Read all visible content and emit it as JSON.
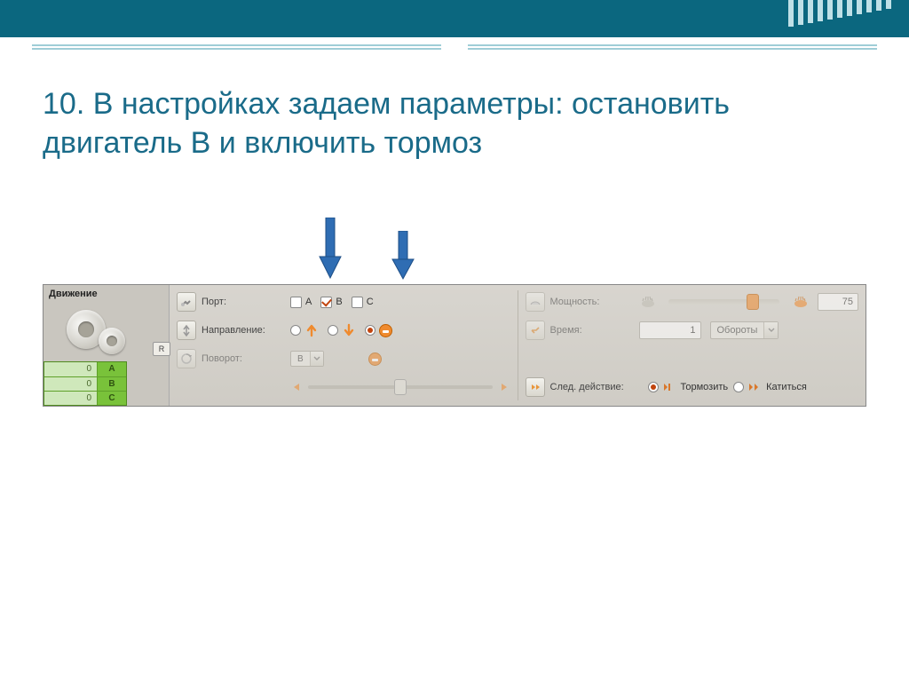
{
  "slide": {
    "heading": "10. В настройках задаем параметры: остановить двигатель В и включить тормоз"
  },
  "panel": {
    "title": "Движение",
    "reset_btn": "R",
    "readout": [
      {
        "value": "0",
        "port": "A"
      },
      {
        "value": "0",
        "port": "B"
      },
      {
        "value": "0",
        "port": "C"
      }
    ],
    "port": {
      "label": "Порт:",
      "options": [
        {
          "letter": "A",
          "checked": false
        },
        {
          "letter": "B",
          "checked": true
        },
        {
          "letter": "C",
          "checked": false
        }
      ]
    },
    "direction": {
      "label": "Направление:",
      "selected": "stop"
    },
    "turn": {
      "label": "Поворот:",
      "motor_select": "B"
    },
    "power": {
      "label": "Мощность:",
      "value": "75"
    },
    "time": {
      "label": "Время:",
      "value": "1",
      "unit": "Обороты"
    },
    "next_action": {
      "label": "След. действие:",
      "brake_label": "Тормозить",
      "coast_label": "Катиться",
      "selected": "brake"
    }
  }
}
